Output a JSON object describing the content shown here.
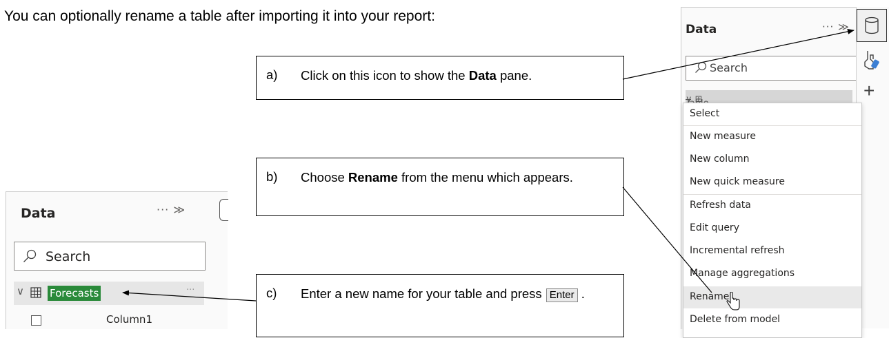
{
  "intro_text": "You can optionally rename a table after importing it into your report:",
  "callouts": {
    "a": {
      "letter": "a)",
      "before": "Click on this icon to show the ",
      "bold": "Data",
      "after": " pane."
    },
    "b": {
      "letter": "b)",
      "before": "Choose ",
      "bold": "Rename",
      "after": " from the menu which appears."
    },
    "c": {
      "letter": "c)",
      "before": "Enter a new name for your table and press ",
      "key": "Enter",
      "after": " ."
    }
  },
  "right_pane": {
    "title": "Data",
    "more": "···",
    "collapse": "≫",
    "search_placeholder": "Search",
    "table_name": "Table 1",
    "menu_items": [
      "Select",
      "New measure",
      "New column",
      "New quick measure",
      "Refresh data",
      "Edit query",
      "Incremental refresh",
      "Manage aggregations",
      "Rename",
      "Delete from model"
    ],
    "highlighted_item": "Rename"
  },
  "left_pane": {
    "title": "Data",
    "more": "···",
    "collapse": "≫",
    "search_placeholder": "Search",
    "table_name": "Forecasts",
    "row_more": "···",
    "column_name": "Column1"
  },
  "icons": {
    "data_pane": "database-icon",
    "format": "format-paint-icon",
    "add": "plus-icon",
    "search": "search-icon",
    "chevron": "chevron-down-icon",
    "table": "table-grid-icon",
    "pointer": "hand-pointer-icon"
  },
  "colors": {
    "rename_highlight": "#2a8a3a"
  }
}
